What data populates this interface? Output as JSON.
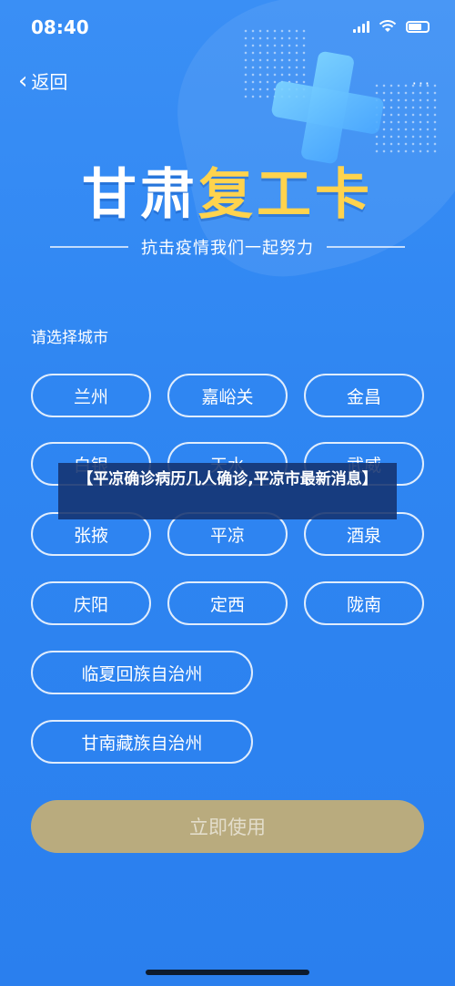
{
  "status_bar": {
    "time": "08:40"
  },
  "nav": {
    "back_label": "返回",
    "back_icon": "chevron-left-icon",
    "more_label": "···"
  },
  "title": {
    "part1": "甘肃",
    "part2": "复工卡"
  },
  "subtitle": "抗击疫情我们一起努力",
  "prompt": "请选择城市",
  "cities": {
    "lanzhou": "兰州",
    "jiayuguan": "嘉峪关",
    "jinchang": "金昌",
    "baiyin": "白银",
    "tianshui": "天水",
    "wuwei": "武威",
    "zhangye": "张掖",
    "pingliang": "平凉",
    "jiuquan": "酒泉",
    "qingyang": "庆阳",
    "dingxi": "定西",
    "longnan": "陇南",
    "linxia": "临夏回族自治州",
    "gannan": "甘南藏族自治州"
  },
  "submit_label": "立即使用",
  "overlay_text": "【平凉确诊病历几人确诊,平凉市最新消息】",
  "colors": {
    "background": "#2f86f2",
    "accent_yellow": "#ffd34d",
    "submit_bg": "#b9ab7e"
  }
}
